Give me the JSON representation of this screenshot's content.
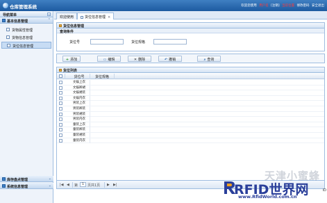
{
  "header": {
    "app_title": "仓库管理系统",
    "links": [
      "欢迎您使用",
      "用户名",
      "[注销]",
      "当前位置",
      "修改密码",
      "安全退出"
    ]
  },
  "sidebar": {
    "title": "导航菜单",
    "group_main": "基本信息管理",
    "items": [
      {
        "label": "货物属性管理",
        "active": false
      },
      {
        "label": "货物信息管理",
        "active": false
      },
      {
        "label": "货位信息管理",
        "active": true
      }
    ],
    "group_bottom_1": "库存盘点管理",
    "group_bottom_2": "系统信息管理"
  },
  "tabs": [
    {
      "label": "欢迎使用",
      "active": false,
      "closable": false
    },
    {
      "label": "货位信息管理",
      "active": true,
      "closable": true
    }
  ],
  "search_panel": {
    "title": "货位信息管理",
    "section": "查询条件",
    "field1_label": "货位号",
    "field1_value": "",
    "field2_label": "货位规格",
    "field2_value": ""
  },
  "toolbar": {
    "add": "添加",
    "edit": "编辑",
    "delete": "删除",
    "cancel": "撤销",
    "query": "查询",
    "add_icon": "+",
    "delete_icon": "✕"
  },
  "grid": {
    "title": "货位列表",
    "columns": [
      "货位号",
      "货位规格"
    ],
    "rows": [
      "文娱上衣",
      "文娱裤裙",
      "文娱裙装",
      "文娱内衣",
      "男装上衣",
      "男装裤装",
      "男装裙装",
      "男装内衣",
      "童装上衣",
      "童装裤装",
      "童装裙装",
      "童装内衣"
    ]
  },
  "pager": {
    "first": "|◀",
    "prev": "◀",
    "page_word_before": "第",
    "page_value": "1",
    "page_word_after": "页共1页",
    "next": "▶",
    "last": "▶|"
  },
  "watermark": {
    "top": "天津小蜜蜂",
    "brand": "RFID世界网",
    "url": "www.RfidWorld.com.cn",
    "tail": "iD"
  }
}
